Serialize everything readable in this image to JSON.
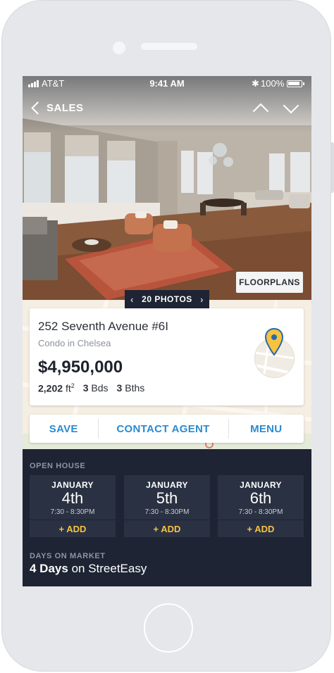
{
  "status_bar": {
    "carrier": "AT&T",
    "time": "9:41 AM",
    "battery": "100%"
  },
  "nav": {
    "back_label": "SALES"
  },
  "hero": {
    "floorplans_label": "FLOORPLANS",
    "photos_label": "20 PHOTOS"
  },
  "listing": {
    "address": "252 Seventh Avenue #6I",
    "subtitle": "Condo in Chelsea",
    "price": "$4,950,000",
    "sqft": "2,202",
    "sqft_unit": "ft",
    "sqft_sup": "2",
    "beds": "3",
    "beds_label": "Bds",
    "baths": "3",
    "baths_label": "Bths"
  },
  "actions": {
    "save": "SAVE",
    "contact": "CONTACT AGENT",
    "menu": "MENU"
  },
  "open_house": {
    "label": "OPEN HOUSE",
    "items": [
      {
        "month": "JANUARY",
        "day": "4th",
        "time": "7:30 - 8:30PM",
        "add": "+ ADD"
      },
      {
        "month": "JANUARY",
        "day": "5th",
        "time": "7:30 - 8:30PM",
        "add": "+ ADD"
      },
      {
        "month": "JANUARY",
        "day": "6th",
        "time": "7:30 - 8:30PM",
        "add": "+ ADD"
      }
    ]
  },
  "days_on_market": {
    "label": "DAYS ON MARKET",
    "value": "4 Days",
    "suffix": "on StreetEasy"
  },
  "colors": {
    "accent": "#2a8bd0",
    "add": "#f6c340",
    "dark_bg": "#1e2433",
    "card_bg": "#2a3142"
  }
}
